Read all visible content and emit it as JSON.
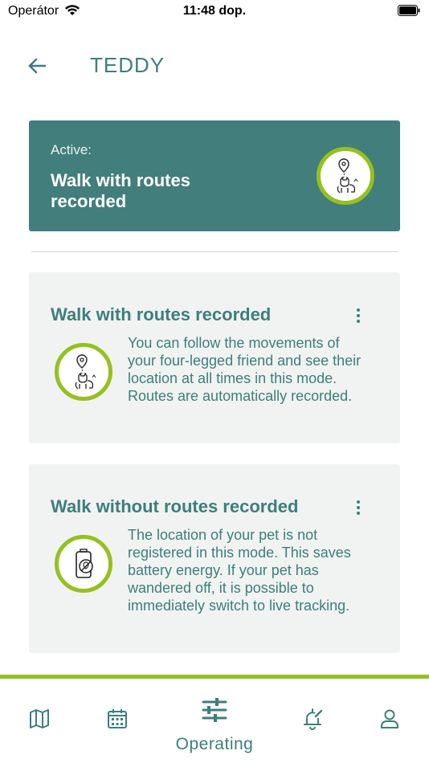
{
  "status_bar": {
    "carrier": "Operátor",
    "time": "11:48 dop."
  },
  "header": {
    "title": "TEDDY",
    "back_icon": "arrow-left-icon"
  },
  "active": {
    "label": "Active:",
    "mode": "Walk with routes recorded",
    "icon": "pet-location-icon"
  },
  "modes": [
    {
      "title": "Walk with routes recorded",
      "description": "You can follow the movements of your four-legged friend and see their location at all times in this mode. Routes are automatically recorded.",
      "icon": "pet-location-icon"
    },
    {
      "title": "Walk without routes recorded",
      "description": "The location of your pet is not registered in this mode. This saves battery energy. If your pet has wandered off, it is possible to immediately switch to live tracking.",
      "icon": "battery-saver-icon"
    }
  ],
  "nav": {
    "items": [
      {
        "icon": "map-icon"
      },
      {
        "icon": "calendar-icon"
      },
      {
        "icon": "sliders-icon",
        "label": "Operating",
        "active": true
      },
      {
        "icon": "alarm-bell-icon"
      },
      {
        "icon": "user-icon"
      }
    ]
  },
  "colors": {
    "primary": "#427e7c",
    "text_teal": "#3c7f7c",
    "accent_green": "#95c11f",
    "card_bg": "#f1f2f2"
  }
}
